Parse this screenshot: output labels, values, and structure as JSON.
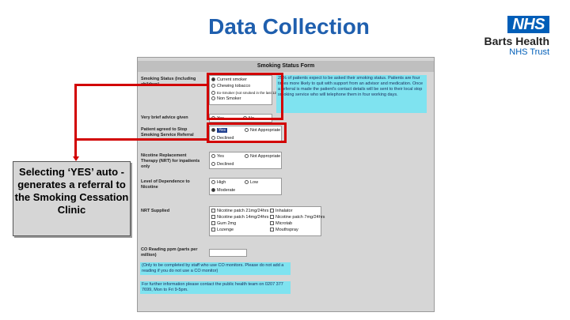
{
  "slide": {
    "title": "Data Collection"
  },
  "logo": {
    "badge": "NHS",
    "org": "Barts Health",
    "sub": "NHS Trust"
  },
  "callout": {
    "text": "Selecting ‘YES’ auto -generates a referral to the Smoking Cessation Clinic"
  },
  "form": {
    "title": "Smoking Status Form",
    "smoking_status": {
      "label": "Smoking Status (including children)",
      "options": [
        "Current smoker",
        "Chewing tobacco",
        "Ex-Smoker (not smoked in the last 12 years)",
        "Non Smoker"
      ],
      "info": "25% of patients expect to be asked their smoking status. Patients are four times more likely to quit with support from an advisor and medication. Once a referral is made the patient's contact details will be sent to their local stop smoking service who will telephone them in four working days."
    },
    "brief_advice": {
      "label": "Very brief advice given",
      "options": [
        "Yes",
        "No"
      ]
    },
    "referral": {
      "label": "Patient agreed to Stop Smoking Service Referral",
      "options": [
        "Yes",
        "Not Appropriate",
        "Declined"
      ]
    },
    "nrt": {
      "label": "Nicotine Replacement Therapy (NRT) for inpatients only",
      "options": [
        "Yes",
        "Not Appropriate",
        "Declined"
      ]
    },
    "dependence": {
      "label": "Level of Dependence to Nicotine",
      "options": [
        "High",
        "Low",
        "Moderate"
      ]
    },
    "nrt_supplied": {
      "label": "NRT Supplied",
      "items": [
        "Nicotine patch 21mg/24hrs",
        "Nicotine patch 14mg/24hrs",
        "Inhalator",
        "Nicotine patch 7mg/24hrs",
        "Gum 2mg",
        "Microtab",
        "Lozenge",
        "Mouthspray"
      ]
    },
    "co_reading": {
      "label": "CO Reading ppm (parts per million)",
      "note": "(Only to be completed by staff who use CO monitors. Please do not add a reading if you do not use a CO monitor)"
    },
    "footer": "For further information please contact the public health team on 0207 377 7699, Mon to Fri 9-5pm."
  }
}
